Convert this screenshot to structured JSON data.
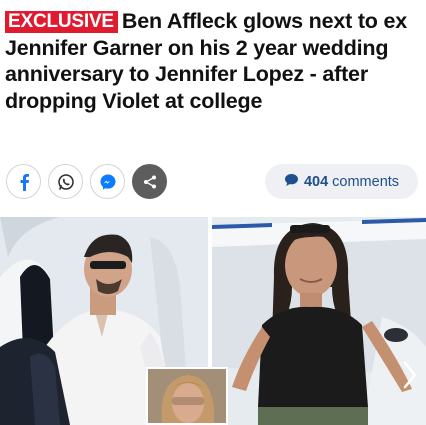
{
  "article": {
    "badge": "EXCLUSIVE",
    "headline": "Ben Affleck glows next to ex Jennifer Garner on his 2 year wedding anniversary to Jennifer Lopez - after dropping Violet at college"
  },
  "share": {
    "buttons": [
      {
        "name": "facebook",
        "icon": "facebook-icon"
      },
      {
        "name": "whatsapp",
        "icon": "whatsapp-icon"
      },
      {
        "name": "messenger",
        "icon": "messenger-icon"
      },
      {
        "name": "more",
        "icon": "share-icon"
      }
    ],
    "comments": {
      "count": "404",
      "label": "comments",
      "icon": "speech-bubble-icon"
    }
  },
  "gallery": {
    "images": [
      {
        "subject": "ben-affleck-photo"
      },
      {
        "subject": "jennifer-garner-photo"
      },
      {
        "subject": "jennifer-lopez-inset"
      }
    ],
    "next_icon": "chevron-right-icon"
  },
  "colors": {
    "badge_bg": "#e01a2f",
    "comments_text": "#1f4f8c",
    "comments_bg": "#eef0f4",
    "facebook": "#1877f2",
    "whatsapp": "#2e2e2e",
    "messenger": "#0a7cff"
  }
}
